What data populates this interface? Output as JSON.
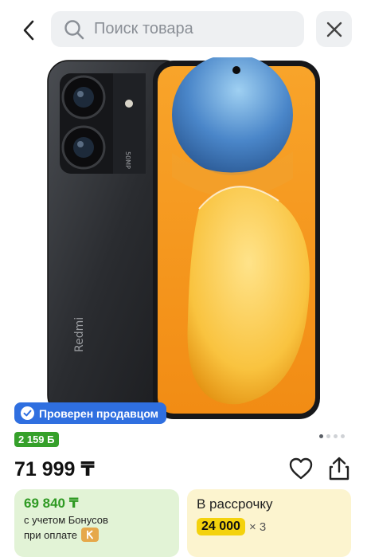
{
  "header": {
    "back_icon": "chevron-left-icon",
    "search_icon": "search-icon",
    "search_placeholder": "Поиск товара",
    "close_icon": "close-icon"
  },
  "product_image": {
    "brand_mark": "Redmi",
    "camera_label": "50MP",
    "colors": {
      "body": "#2a2c30",
      "screen_orange": "#f79a1f",
      "screen_blue": "#4a86c9"
    }
  },
  "badges": {
    "verified_icon": "check-circle-icon",
    "verified_label": "Проверен продавцом",
    "bonus_label": "2 159 Б"
  },
  "gallery": {
    "total": 4,
    "current": 1
  },
  "price": {
    "main": "71 999 ₸",
    "fav_icon": "heart-icon",
    "share_icon": "share-icon"
  },
  "bonus_card": {
    "amount": "69 840 ₸",
    "line1": "с учетом Бонусов",
    "line2": "при оплате",
    "badge_icon": "kaspi-icon"
  },
  "installment_card": {
    "title": "В рассрочку",
    "amount": "24 000",
    "multiplier": "× 3"
  },
  "colors": {
    "accent_blue": "#2f6fe0",
    "bonus_green": "#35a02a",
    "installment_yellow": "#f4d20d"
  }
}
